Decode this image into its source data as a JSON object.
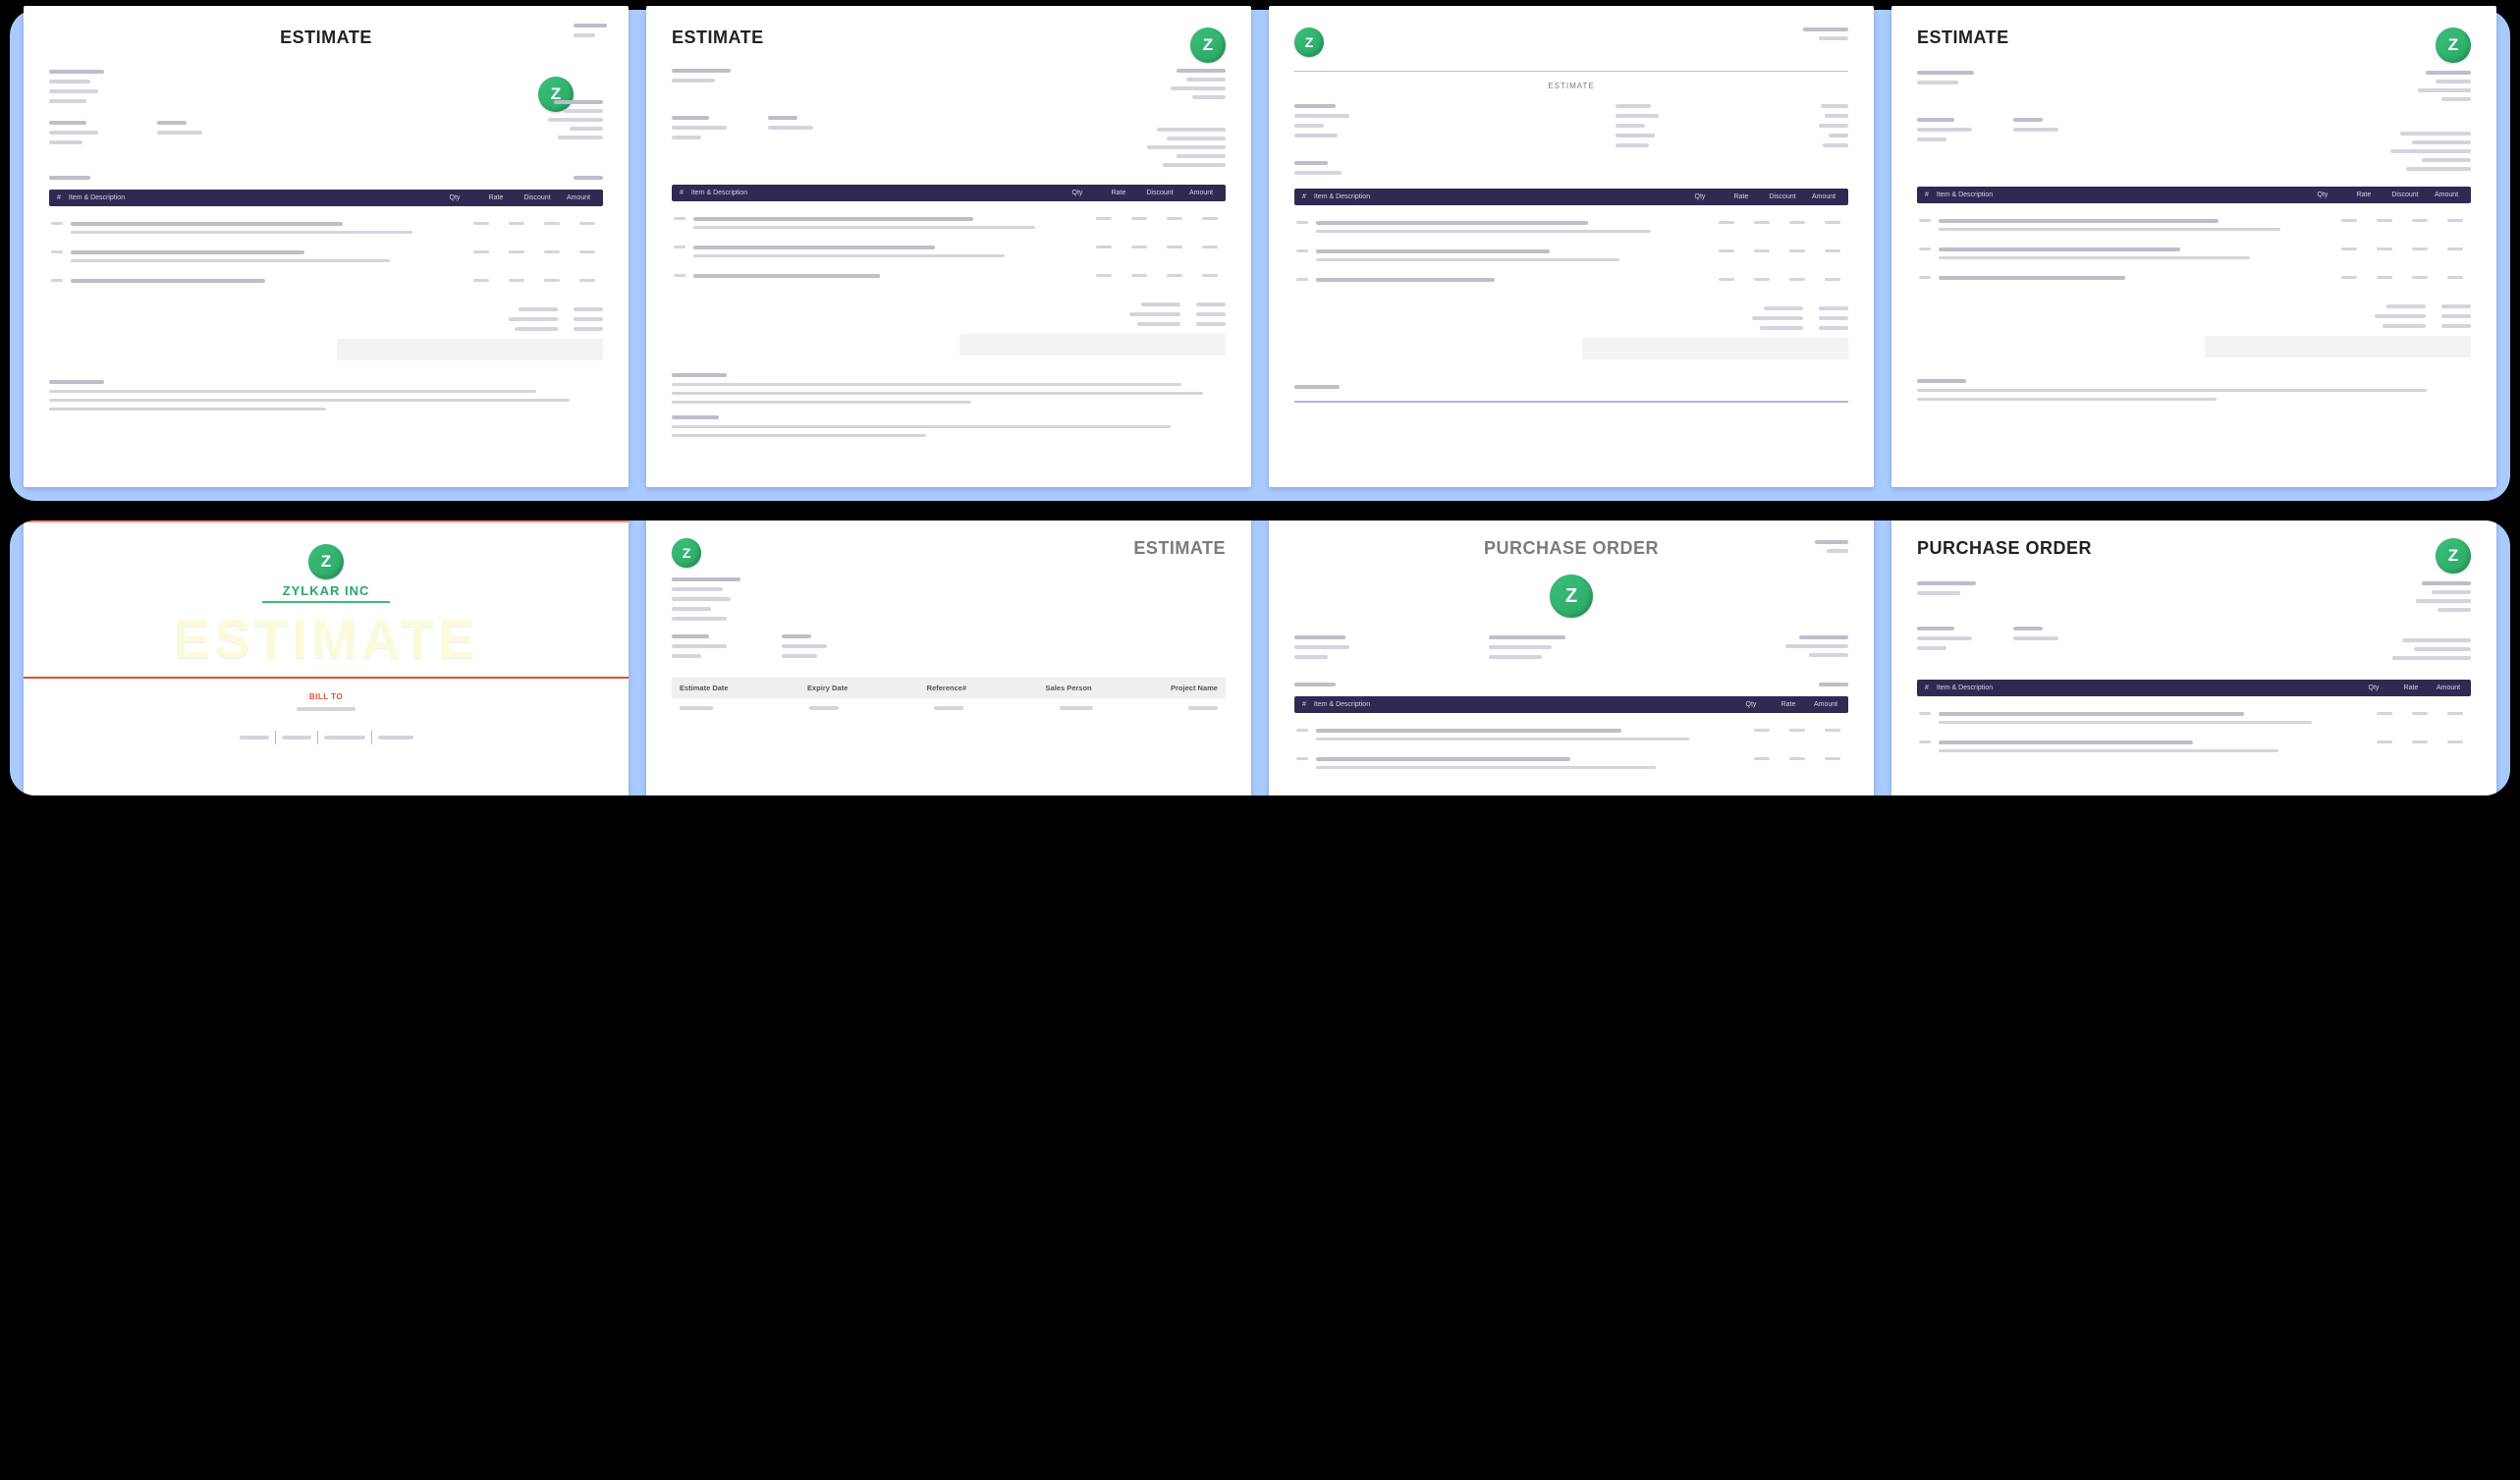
{
  "logo_letter": "Z",
  "titles": {
    "estimate": "ESTIMATE",
    "purchase_order": "PURCHASE ORDER"
  },
  "columns_full": {
    "num": "#",
    "item": "Item & Description",
    "qty": "Qty",
    "rate": "Rate",
    "discount": "Discount",
    "amount": "Amount"
  },
  "columns_po": {
    "num": "#",
    "item": "Item & Description",
    "qty": "Qty",
    "rate": "Rate",
    "amount": "Amount"
  },
  "columns_light": {
    "estimate_date": "Estimate Date",
    "expiry_date": "Expiry Date",
    "reference": "Reference#",
    "sales_person": "Sales Person",
    "project_name": "Project Name"
  },
  "card5": {
    "company": "ZYLKAR INC",
    "watermark": "ESTIMATE",
    "bill_to": "BILL TO"
  }
}
